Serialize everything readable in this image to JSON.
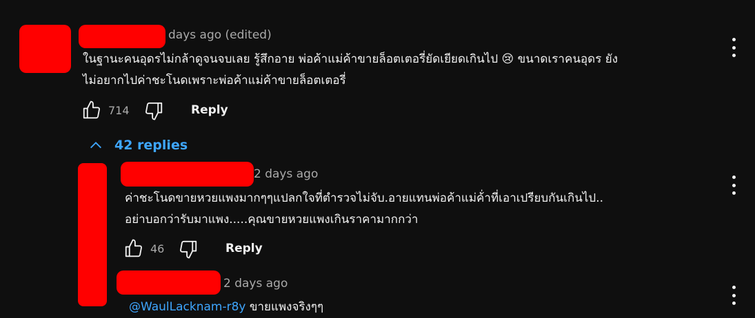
{
  "comment": {
    "timestamp": "days ago (edited)",
    "text_line1": "ในฐานะคนอุดรไม่กล้าดูจนจบเลย รู้สึกอาย พ่อค้าแม่ค้าขายล็อตเตอรี่ยัดเยียดเกินไป 😢 ขนาดเราคนอุดร ยัง",
    "text_line2": "ไม่อยากไปค่าชะโนดเพราะพ่อค้าแม่ค้าขายล็อตเตอรี่",
    "like_count": "714",
    "reply_label": "Reply",
    "replies_toggle": "42 replies"
  },
  "reply1": {
    "timestamp": "2 days ago",
    "text_line1": "ค่าชะโนดขายหวยแพงมากๆๆแปลกใจที่ตำรวจไม่จับ.อายแทนพ่อค้าแม่ค้่าที่เอาเปรียบกันเกินไป..",
    "text_line2": "อย่าบอกว่ารับมาแพง.....คุณขายหวยแพงเกินราคามากกว่า",
    "like_count": "46",
    "reply_label": "Reply"
  },
  "reply2": {
    "timestamp": "2 days ago",
    "mention": "@WaulLacknam-r8y",
    "text_partial": " ขายแพงจริงๆๆ"
  },
  "icons": {
    "like": "thumbs-up-icon",
    "dislike": "thumbs-down-icon",
    "more": "more-vert-icon",
    "collapse": "chevron-up-icon"
  },
  "colors": {
    "background": "#0f0f0f",
    "link": "#3ea6ff",
    "redaction": "#ff0000",
    "muted": "#aaaaaa"
  }
}
